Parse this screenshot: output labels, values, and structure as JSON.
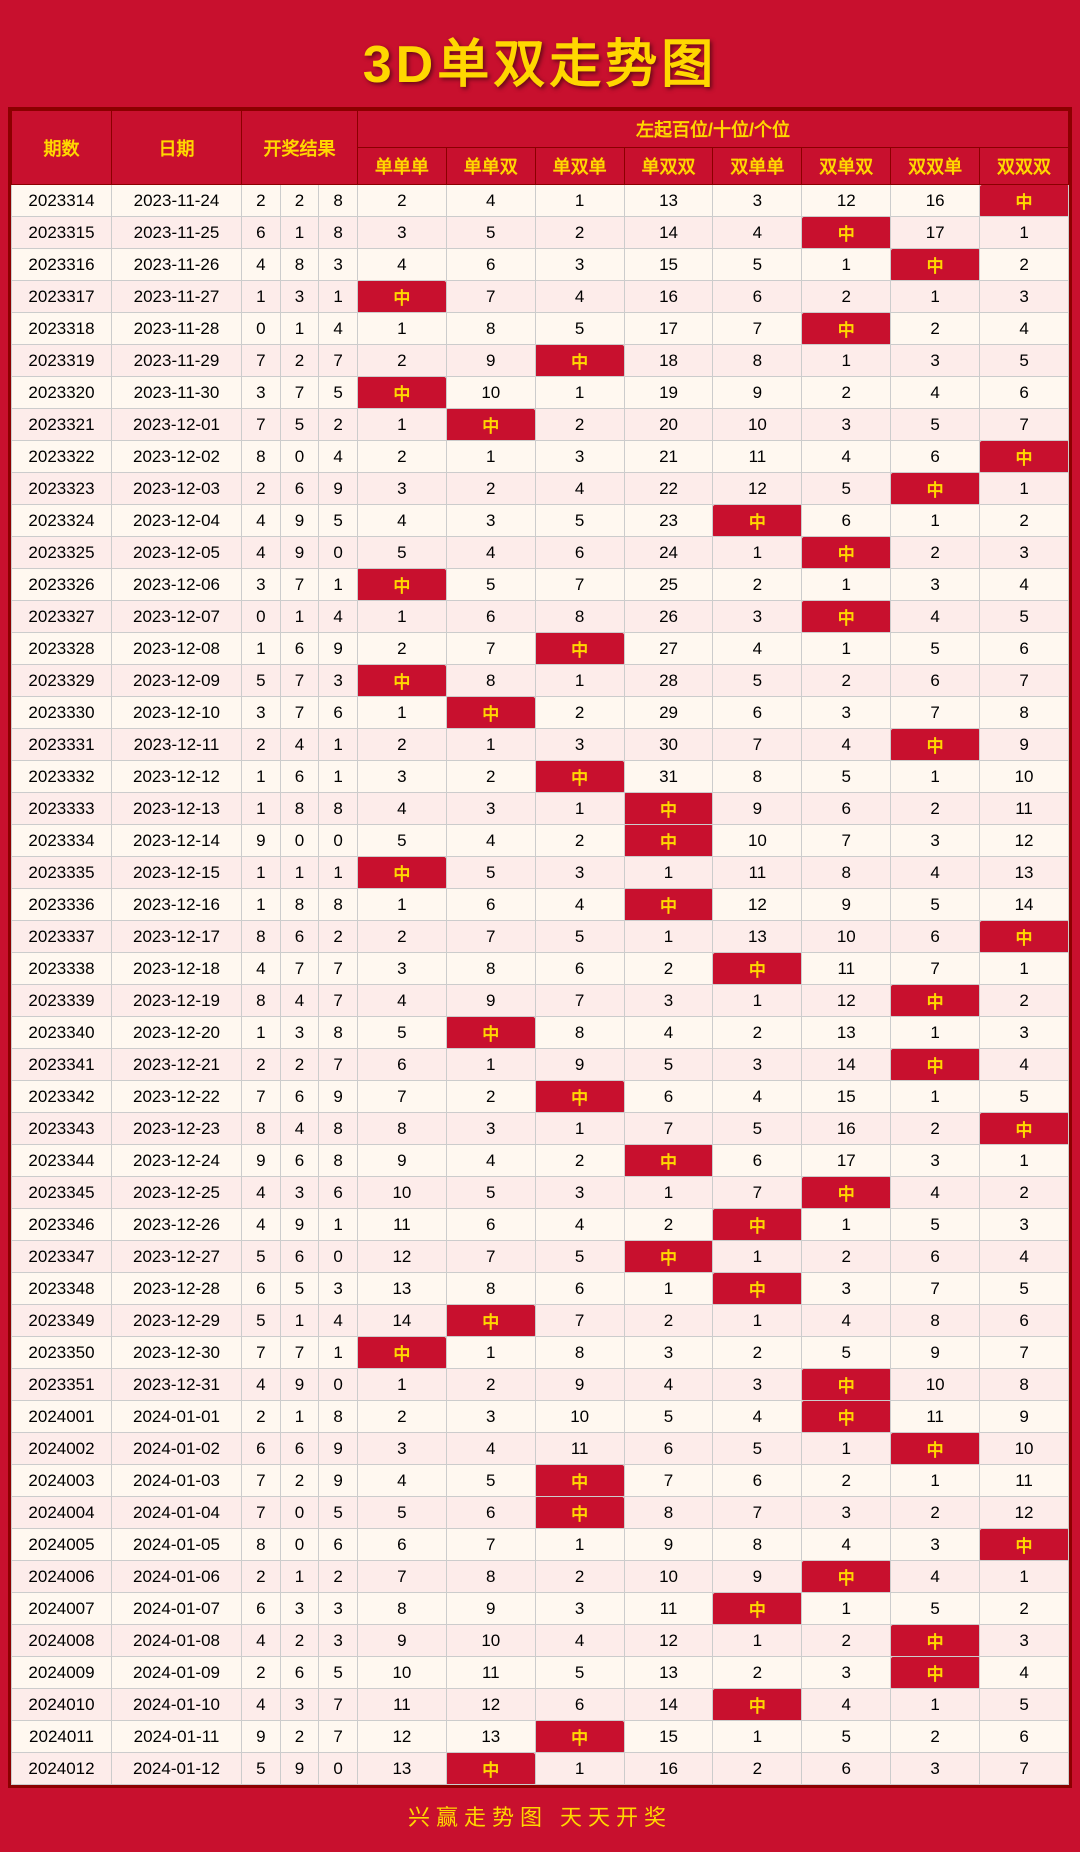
{
  "title": "3D单双走势图",
  "subtitle": "左起百位/十位/个位",
  "headers": {
    "period": "期数",
    "date": "日期",
    "open": "开奖结果",
    "cols": [
      "单单单",
      "单单双",
      "单双单",
      "单双双",
      "双单单",
      "双单双",
      "双双单",
      "双双双"
    ]
  },
  "footer": "兴赢走势图   天天开奖",
  "rows": [
    {
      "id": "2023314",
      "date": "2023-11-24",
      "d": [
        2,
        2,
        8
      ],
      "v": [
        2,
        4,
        1,
        13,
        3,
        12,
        16,
        "中"
      ]
    },
    {
      "id": "2023315",
      "date": "2023-11-25",
      "d": [
        6,
        1,
        8
      ],
      "v": [
        3,
        5,
        2,
        14,
        4,
        "中",
        17,
        1
      ]
    },
    {
      "id": "2023316",
      "date": "2023-11-26",
      "d": [
        4,
        8,
        3
      ],
      "v": [
        4,
        6,
        3,
        15,
        5,
        1,
        "中",
        2
      ]
    },
    {
      "id": "2023317",
      "date": "2023-11-27",
      "d": [
        1,
        3,
        1
      ],
      "v": [
        "中",
        7,
        4,
        16,
        6,
        2,
        1,
        3
      ]
    },
    {
      "id": "2023318",
      "date": "2023-11-28",
      "d": [
        0,
        1,
        4
      ],
      "v": [
        1,
        8,
        5,
        17,
        7,
        "中",
        2,
        4
      ]
    },
    {
      "id": "2023319",
      "date": "2023-11-29",
      "d": [
        7,
        2,
        7
      ],
      "v": [
        2,
        9,
        "中",
        18,
        8,
        1,
        3,
        5
      ]
    },
    {
      "id": "2023320",
      "date": "2023-11-30",
      "d": [
        3,
        7,
        5
      ],
      "v": [
        "中",
        10,
        1,
        19,
        9,
        2,
        4,
        6
      ]
    },
    {
      "id": "2023321",
      "date": "2023-12-01",
      "d": [
        7,
        5,
        2
      ],
      "v": [
        1,
        "中",
        2,
        20,
        10,
        3,
        5,
        7
      ]
    },
    {
      "id": "2023322",
      "date": "2023-12-02",
      "d": [
        8,
        0,
        4
      ],
      "v": [
        2,
        1,
        3,
        21,
        11,
        4,
        6,
        "中"
      ]
    },
    {
      "id": "2023323",
      "date": "2023-12-03",
      "d": [
        2,
        6,
        9
      ],
      "v": [
        3,
        2,
        4,
        22,
        12,
        5,
        "中",
        1
      ]
    },
    {
      "id": "2023324",
      "date": "2023-12-04",
      "d": [
        4,
        9,
        5
      ],
      "v": [
        4,
        3,
        5,
        23,
        "中",
        6,
        1,
        2
      ]
    },
    {
      "id": "2023325",
      "date": "2023-12-05",
      "d": [
        4,
        9,
        0
      ],
      "v": [
        5,
        4,
        6,
        24,
        1,
        "中",
        2,
        3
      ]
    },
    {
      "id": "2023326",
      "date": "2023-12-06",
      "d": [
        3,
        7,
        1
      ],
      "v": [
        "中",
        5,
        7,
        25,
        2,
        1,
        3,
        4
      ]
    },
    {
      "id": "2023327",
      "date": "2023-12-07",
      "d": [
        0,
        1,
        4
      ],
      "v": [
        1,
        6,
        8,
        26,
        3,
        "中",
        4,
        5
      ]
    },
    {
      "id": "2023328",
      "date": "2023-12-08",
      "d": [
        1,
        6,
        9
      ],
      "v": [
        2,
        7,
        "中",
        27,
        4,
        1,
        5,
        6
      ]
    },
    {
      "id": "2023329",
      "date": "2023-12-09",
      "d": [
        5,
        7,
        3
      ],
      "v": [
        "中",
        8,
        1,
        28,
        5,
        2,
        6,
        7
      ]
    },
    {
      "id": "2023330",
      "date": "2023-12-10",
      "d": [
        3,
        7,
        6
      ],
      "v": [
        1,
        "中",
        2,
        29,
        6,
        3,
        7,
        8
      ]
    },
    {
      "id": "2023331",
      "date": "2023-12-11",
      "d": [
        2,
        4,
        1
      ],
      "v": [
        2,
        1,
        3,
        30,
        7,
        4,
        "中",
        9
      ]
    },
    {
      "id": "2023332",
      "date": "2023-12-12",
      "d": [
        1,
        6,
        1
      ],
      "v": [
        3,
        2,
        "中",
        31,
        8,
        5,
        1,
        10
      ]
    },
    {
      "id": "2023333",
      "date": "2023-12-13",
      "d": [
        1,
        8,
        8
      ],
      "v": [
        4,
        3,
        1,
        "中",
        9,
        6,
        2,
        11
      ]
    },
    {
      "id": "2023334",
      "date": "2023-12-14",
      "d": [
        9,
        0,
        0
      ],
      "v": [
        5,
        4,
        2,
        "中",
        10,
        7,
        3,
        12
      ]
    },
    {
      "id": "2023335",
      "date": "2023-12-15",
      "d": [
        1,
        1,
        1
      ],
      "v": [
        "中",
        5,
        3,
        1,
        11,
        8,
        4,
        13
      ]
    },
    {
      "id": "2023336",
      "date": "2023-12-16",
      "d": [
        1,
        8,
        8
      ],
      "v": [
        1,
        6,
        4,
        "中",
        12,
        9,
        5,
        14
      ]
    },
    {
      "id": "2023337",
      "date": "2023-12-17",
      "d": [
        8,
        6,
        2
      ],
      "v": [
        2,
        7,
        5,
        1,
        13,
        10,
        6,
        "中"
      ]
    },
    {
      "id": "2023338",
      "date": "2023-12-18",
      "d": [
        4,
        7,
        7
      ],
      "v": [
        3,
        8,
        6,
        2,
        "中",
        11,
        7,
        1
      ]
    },
    {
      "id": "2023339",
      "date": "2023-12-19",
      "d": [
        8,
        4,
        7
      ],
      "v": [
        4,
        9,
        7,
        3,
        1,
        12,
        "中",
        2
      ]
    },
    {
      "id": "2023340",
      "date": "2023-12-20",
      "d": [
        1,
        3,
        8
      ],
      "v": [
        5,
        "中",
        8,
        4,
        2,
        13,
        1,
        3
      ]
    },
    {
      "id": "2023341",
      "date": "2023-12-21",
      "d": [
        2,
        2,
        7
      ],
      "v": [
        6,
        1,
        9,
        5,
        3,
        14,
        "中",
        4
      ]
    },
    {
      "id": "2023342",
      "date": "2023-12-22",
      "d": [
        7,
        6,
        9
      ],
      "v": [
        7,
        2,
        "中",
        6,
        4,
        15,
        1,
        5
      ]
    },
    {
      "id": "2023343",
      "date": "2023-12-23",
      "d": [
        8,
        4,
        8
      ],
      "v": [
        8,
        3,
        1,
        7,
        5,
        16,
        2,
        "中"
      ]
    },
    {
      "id": "2023344",
      "date": "2023-12-24",
      "d": [
        9,
        6,
        8
      ],
      "v": [
        9,
        4,
        2,
        "中",
        6,
        17,
        3,
        1
      ]
    },
    {
      "id": "2023345",
      "date": "2023-12-25",
      "d": [
        4,
        3,
        6
      ],
      "v": [
        10,
        5,
        3,
        1,
        7,
        "中",
        4,
        2
      ]
    },
    {
      "id": "2023346",
      "date": "2023-12-26",
      "d": [
        4,
        9,
        1
      ],
      "v": [
        11,
        6,
        4,
        2,
        "中",
        1,
        5,
        3
      ]
    },
    {
      "id": "2023347",
      "date": "2023-12-27",
      "d": [
        5,
        6,
        0
      ],
      "v": [
        12,
        7,
        5,
        "中",
        1,
        2,
        6,
        4
      ]
    },
    {
      "id": "2023348",
      "date": "2023-12-28",
      "d": [
        6,
        5,
        3
      ],
      "v": [
        13,
        8,
        6,
        1,
        "中",
        3,
        7,
        5
      ]
    },
    {
      "id": "2023349",
      "date": "2023-12-29",
      "d": [
        5,
        1,
        4
      ],
      "v": [
        14,
        "中",
        7,
        2,
        1,
        4,
        8,
        6
      ]
    },
    {
      "id": "2023350",
      "date": "2023-12-30",
      "d": [
        7,
        7,
        1
      ],
      "v": [
        "中",
        1,
        8,
        3,
        2,
        5,
        9,
        7
      ]
    },
    {
      "id": "2023351",
      "date": "2023-12-31",
      "d": [
        4,
        9,
        0
      ],
      "v": [
        1,
        2,
        9,
        4,
        3,
        "中",
        10,
        8
      ]
    },
    {
      "id": "2024001",
      "date": "2024-01-01",
      "d": [
        2,
        1,
        8
      ],
      "v": [
        2,
        3,
        10,
        5,
        4,
        "中",
        11,
        9
      ]
    },
    {
      "id": "2024002",
      "date": "2024-01-02",
      "d": [
        6,
        6,
        9
      ],
      "v": [
        3,
        4,
        11,
        6,
        5,
        1,
        "中",
        10
      ]
    },
    {
      "id": "2024003",
      "date": "2024-01-03",
      "d": [
        7,
        2,
        9
      ],
      "v": [
        4,
        5,
        "中",
        7,
        6,
        2,
        1,
        11
      ]
    },
    {
      "id": "2024004",
      "date": "2024-01-04",
      "d": [
        7,
        0,
        5
      ],
      "v": [
        5,
        6,
        "中",
        8,
        7,
        3,
        2,
        12
      ]
    },
    {
      "id": "2024005",
      "date": "2024-01-05",
      "d": [
        8,
        0,
        6
      ],
      "v": [
        6,
        7,
        1,
        9,
        8,
        4,
        3,
        "中"
      ]
    },
    {
      "id": "2024006",
      "date": "2024-01-06",
      "d": [
        2,
        1,
        2
      ],
      "v": [
        7,
        8,
        2,
        10,
        9,
        "中",
        4,
        1
      ]
    },
    {
      "id": "2024007",
      "date": "2024-01-07",
      "d": [
        6,
        3,
        3
      ],
      "v": [
        8,
        9,
        3,
        11,
        "中",
        1,
        5,
        2
      ]
    },
    {
      "id": "2024008",
      "date": "2024-01-08",
      "d": [
        4,
        2,
        3
      ],
      "v": [
        9,
        10,
        4,
        12,
        1,
        2,
        "中",
        3
      ]
    },
    {
      "id": "2024009",
      "date": "2024-01-09",
      "d": [
        2,
        6,
        5
      ],
      "v": [
        10,
        11,
        5,
        13,
        2,
        3,
        "中",
        4
      ]
    },
    {
      "id": "2024010",
      "date": "2024-01-10",
      "d": [
        4,
        3,
        7
      ],
      "v": [
        11,
        12,
        6,
        14,
        "中",
        4,
        1,
        5
      ]
    },
    {
      "id": "2024011",
      "date": "2024-01-11",
      "d": [
        9,
        2,
        7
      ],
      "v": [
        12,
        13,
        "中",
        15,
        1,
        5,
        2,
        6
      ]
    },
    {
      "id": "2024012",
      "date": "2024-01-12",
      "d": [
        5,
        9,
        0
      ],
      "v": [
        13,
        "中",
        1,
        16,
        2,
        6,
        3,
        7
      ]
    }
  ]
}
